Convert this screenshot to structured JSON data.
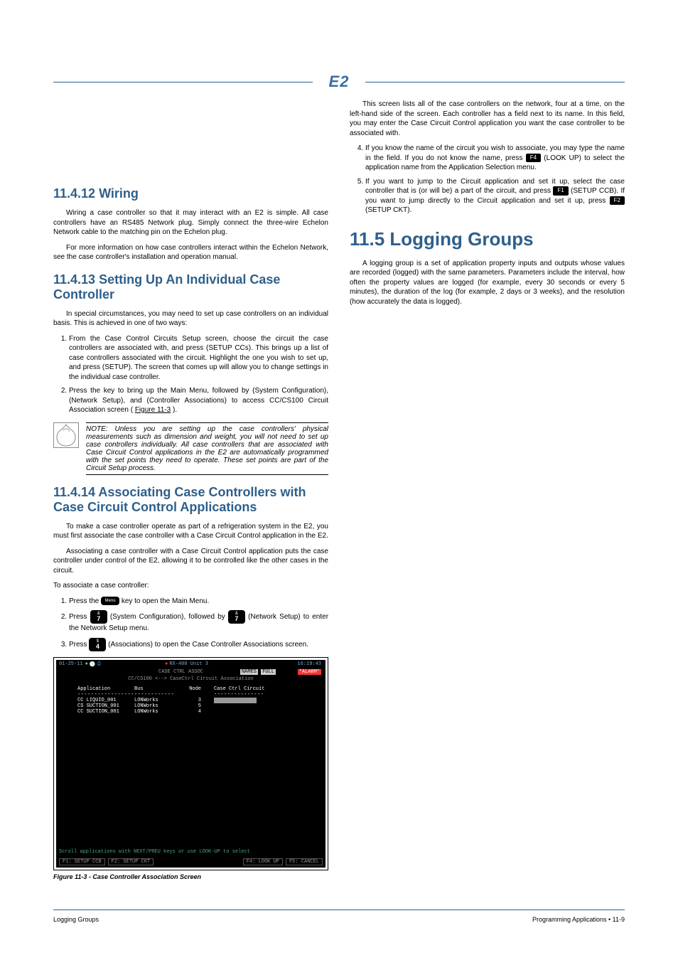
{
  "header": {
    "logo": "E2"
  },
  "sections": {
    "wiring": {
      "heading": "11.4.12 Wiring",
      "p1": "Wiring a case controller so that it may interact with an E2 is simple. All case controllers have an RS485 Network plug. Simply connect the three-wire Echelon Network cable to the matching pin on the Echelon plug.",
      "p2": "For more information on how case controllers interact within the Echelon Network, see the case controller's installation and operation manual."
    },
    "individual": {
      "heading": "11.4.13 Setting Up An Individual Case Controller",
      "p1": "In special circumstances, you may need to set up case controllers on an individual basis. This is achieved in one of two ways:",
      "li1": "From the Case Control Circuits Setup screen, choose the circuit the case controllers are associated with, and press (SETUP CCs). This brings up a list of case controllers associated with the circuit. Highlight the one you wish to set up, and press (SETUP). The screen that comes up will allow you to change settings in the individual case controller.",
      "li2_a": "Press the key to bring up the Main Menu, followed by (System Configuration), (Network Setup), and (Controller Associations) to access CC/CS100 Circuit Association screen (",
      "li2_fig": "Figure 11-3",
      "li2_b": ").",
      "note": "NOTE: Unless you are setting up the case controllers' physical measurements such as dimension and weight, you will not need to set up case controllers individually. All case controllers that are associated with Case Circuit Control applications in the E2 are automatically programmed with the set points they need to operate. These set points are part of the Circuit Setup process.",
      "li1_pref": "1."
    },
    "associating": {
      "heading": "11.4.14 Associating Case Controllers with Case Circuit Control Applications",
      "p1": "To make a case controller operate as part of a refrigeration system in the E2, you must first associate the case controller with a Case Circuit Control application in the E2.",
      "p2": "Associating a case controller with a Case Circuit Control application puts the case controller under control of the E2, allowing it to be controlled like the other cases in the circuit.",
      "steps_intro": "To associate a case controller:",
      "s1_a": "Press the ",
      "s1_b": " key to open the Main Menu.",
      "s2_a": "Press ",
      "s2_b": " (System Configuration), followed by ",
      "s2_c": " (Network Setup) to enter the Network Setup menu.",
      "s3_a": "Press ",
      "s3_b": " (Associations) to open the Case Controller Associations screen."
    },
    "figure": {
      "caption": "Figure 11-3 - Case Controller Association Screen",
      "p1": "This screen lists all of the case controllers on the network, four at a time, on the left-hand side of the screen. Each controller has a field next to its name. In this field, you may enter the Case Circuit Control application you want the case controller to be associated with.",
      "li4_a": "If you know the name of the circuit you wish to associate, you may type the name in the field. If you do not know the name, press ",
      "li4_b": " (LOOK UP) to select the application name from the Application Selection menu.",
      "li5_a": "If you want to jump to the Circuit application and set it up, select the case controller that is (or will be) a part of the circuit, and press ",
      "li5_b": " (SETUP CCB). If you want to jump directly to the Circuit application and set it up, press ",
      "li5_c": " (SETUP CKT)."
    },
    "logging": {
      "heading": "11.5  Logging Groups",
      "p1": "A logging group is a set of application property inputs and outputs whose values are recorded (logged) with the same parameters. Parameters include the interval, how often the property values are logged (for example, every 30 seconds or every 5 minutes), the duration of the log (for example, 2 days or 3 weeks), and the resolution (how accurately the data is logged)."
    }
  },
  "terminal": {
    "date": "01-25-11",
    "unit": "RX-400 Unit 3",
    "cca": "CASE CTRL ASSOC",
    "names_label": "NAMES",
    "names_val": "FULL",
    "clock": "16:19:43",
    "alarm": "*ALARM*",
    "title": "CC/CS100 <--> CaseCtrl Circuit Association",
    "hdr1": "Application",
    "hdr2": "Bus",
    "hdr3": "Node",
    "hdr4": "Case Ctrl Circuit",
    "r1n": "CC LIQUID_001",
    "r1b": "LONWorks",
    "r1m": "3",
    "r2n": "CS SUCTION_001",
    "r2b": "LONWorks",
    "r2m": "5",
    "r3n": "CC SUCTION_001",
    "r3b": "LONWorks",
    "r3m": "4",
    "hint": "Scroll applications with NEXT/PREU keys or use LOOK-UP to select",
    "f1": "F1: SETUP CCB",
    "f2": "F2: SETUP CKT",
    "f4": "F4: LOOK UP",
    "f5": "F5: CANCEL"
  },
  "keys": {
    "menu": "Menu",
    "amp": "&",
    "seven": "7",
    "dollar": "$",
    "four": "4",
    "f1": "F1",
    "f2": "F2",
    "f4": "F4"
  },
  "footer": {
    "left": "Logging Groups",
    "right": "Programming Applications • 11-9"
  }
}
